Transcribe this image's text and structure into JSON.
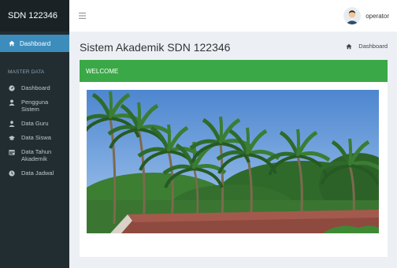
{
  "brand": {
    "title": "SDN 122346"
  },
  "sidebar": {
    "active_item": {
      "label": "Dashboard",
      "icon": "home-icon"
    },
    "section_header": "MASTER DATA",
    "items": [
      {
        "label": "Dashboard",
        "icon": "dashboard-icon"
      },
      {
        "label": "Pengguna Sistem",
        "icon": "user-icon"
      },
      {
        "label": "Data Guru",
        "icon": "teacher-icon"
      },
      {
        "label": "Data Siswa",
        "icon": "graduation-cap-icon"
      },
      {
        "label": "Data Tahun Akademik",
        "icon": "calendar-icon"
      },
      {
        "label": "Data Jadwal",
        "icon": "clock-icon"
      }
    ]
  },
  "topbar": {
    "username": "operator",
    "menu_icon": "hamburger-icon"
  },
  "content": {
    "title": "Sistem Akademik SDN 122346",
    "breadcrumb": "Dashboard"
  },
  "box": {
    "header": "WELCOME"
  },
  "colors": {
    "sidebar_bg": "#222d32",
    "active_item": "#3c8dbc",
    "welcome_header": "#3aa846",
    "content_bg": "#ecf0f5"
  }
}
